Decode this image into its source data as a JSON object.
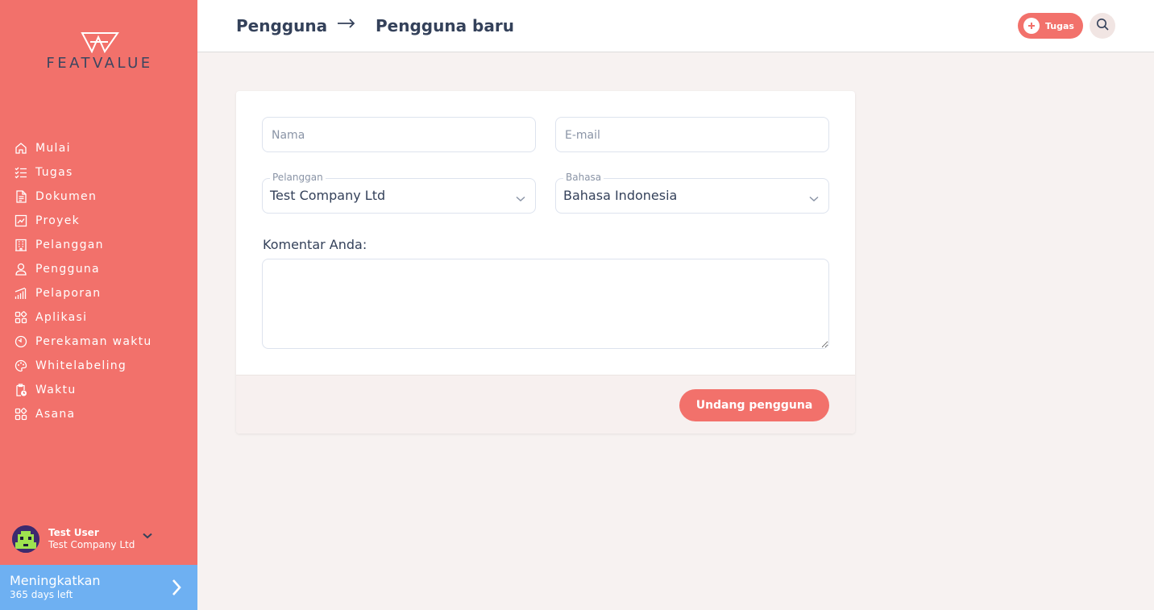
{
  "app": {
    "brand": "FEATVALUE"
  },
  "sidebar": {
    "items": [
      {
        "label": "Mulai",
        "icon": "home-icon"
      },
      {
        "label": "Tugas",
        "icon": "checklist-icon"
      },
      {
        "label": "Dokumen",
        "icon": "document-icon"
      },
      {
        "label": "Proyek",
        "icon": "project-chart-icon"
      },
      {
        "label": "Pelanggan",
        "icon": "building-icon"
      },
      {
        "label": "Pengguna",
        "icon": "user-icon"
      },
      {
        "label": "Pelaporan",
        "icon": "bar-chart-icon"
      },
      {
        "label": "Aplikasi",
        "icon": "apps-icon"
      },
      {
        "label": "Perekaman waktu",
        "icon": "timer-icon"
      },
      {
        "label": "Whitelabeling",
        "icon": "palette-icon"
      },
      {
        "label": "Waktu",
        "icon": "clipboard-clock-icon"
      },
      {
        "label": "Asana",
        "icon": "apps-icon"
      }
    ],
    "user": {
      "name": "Test User",
      "company": "Test Company Ltd"
    },
    "upgrade": {
      "title": "Meningkatkan",
      "subtitle": "365 days left"
    }
  },
  "header": {
    "breadcrumb": {
      "parent": "Pengguna",
      "current": "Pengguna baru"
    },
    "task_button": "Tugas"
  },
  "form": {
    "name_placeholder": "Nama",
    "email_placeholder": "E-mail",
    "customer": {
      "legend": "Pelanggan",
      "value": "Test Company Ltd"
    },
    "language": {
      "legend": "Bahasa",
      "value": "Bahasa Indonesia"
    },
    "comment_label": "Komentar Anda:",
    "comment_value": "",
    "submit_label": "Undang pengguna"
  },
  "colors": {
    "accent": "#f2716b",
    "upgrade": "#6eb0f2",
    "text_dark": "#34415a",
    "background": "#f7f2f1"
  }
}
